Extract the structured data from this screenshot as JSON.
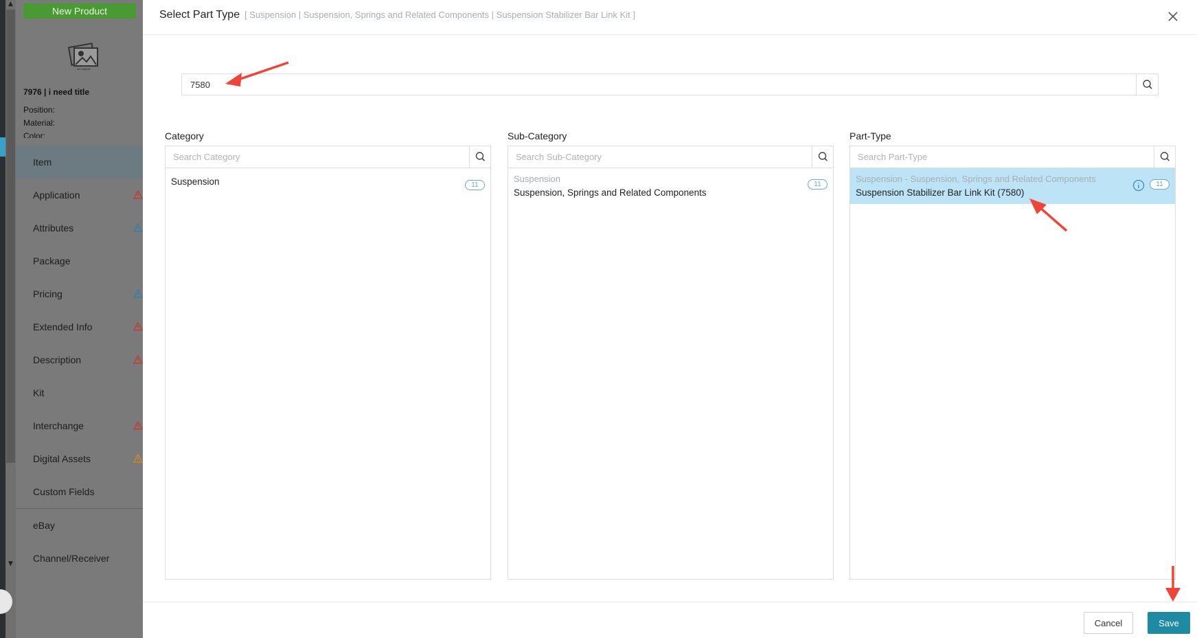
{
  "background": {
    "new_product_label": "New Product",
    "no_image_label": "NO IMAGE",
    "item_title": "7976 | i need title",
    "meta": {
      "position": "Position:",
      "material": "Material:",
      "color": "Color:"
    },
    "nav": [
      {
        "label": "Item",
        "warn": null
      },
      {
        "label": "Application",
        "warn": "#c0392b"
      },
      {
        "label": "Attributes",
        "warn": "#2e7fa8"
      },
      {
        "label": "Package",
        "warn": null
      },
      {
        "label": "Pricing",
        "warn": "#2e7fa8"
      },
      {
        "label": "Extended Info",
        "warn": "#c0392b"
      },
      {
        "label": "Description",
        "warn": "#c0392b"
      },
      {
        "label": "Kit",
        "warn": null
      },
      {
        "label": "Interchange",
        "warn": "#c0392b"
      },
      {
        "label": "Digital Assets",
        "warn": "#d68a1c"
      },
      {
        "label": "Custom Fields",
        "warn": null
      },
      {
        "label": "eBay",
        "warn": null
      },
      {
        "label": "Channel/Receiver",
        "warn": null
      }
    ]
  },
  "modal": {
    "title": "Select Part Type",
    "breadcrumb": "[ Suspension | Suspension, Springs and Related Components | Suspension Stabilizer Bar Link Kit ]",
    "search_value": "7580",
    "columns": {
      "category": {
        "label": "Category",
        "placeholder": "Search Category",
        "items": [
          {
            "sub": "",
            "main": "Suspension",
            "count": "11"
          }
        ]
      },
      "subcategory": {
        "label": "Sub-Category",
        "placeholder": "Search Sub-Category",
        "items": [
          {
            "sub": "Suspension",
            "main": "Suspension, Springs and Related Components",
            "count": "11"
          }
        ]
      },
      "parttype": {
        "label": "Part-Type",
        "placeholder": "Search Part-Type",
        "items": [
          {
            "sub": "Suspension - Suspension, Springs and Related Components",
            "main": "Suspension Stabilizer Bar Link Kit (7580)",
            "count": "11"
          }
        ]
      }
    },
    "footer": {
      "cancel_label": "Cancel",
      "save_label": "Save"
    }
  },
  "colors": {
    "accent": "#1f8aa3",
    "selected_row": "#bde3f7",
    "badge": "#6aa7cc",
    "annotation": "#f04438"
  }
}
